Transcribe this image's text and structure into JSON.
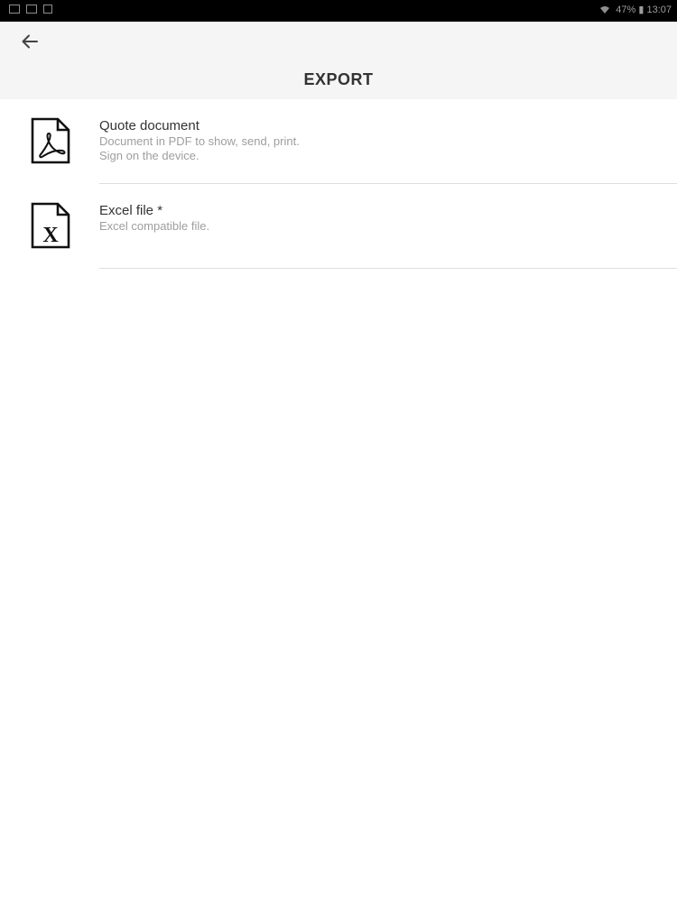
{
  "status_bar": {
    "right_text": "47% ▮ 13:07"
  },
  "header": {
    "title": "EXPORT"
  },
  "items": [
    {
      "icon": "pdf-file-icon",
      "title": "Quote document",
      "line1": "Document in PDF to show, send, print.",
      "line2": "Sign on the device."
    },
    {
      "icon": "excel-file-icon",
      "title": "Excel file *",
      "line1": "Excel compatible file."
    }
  ]
}
